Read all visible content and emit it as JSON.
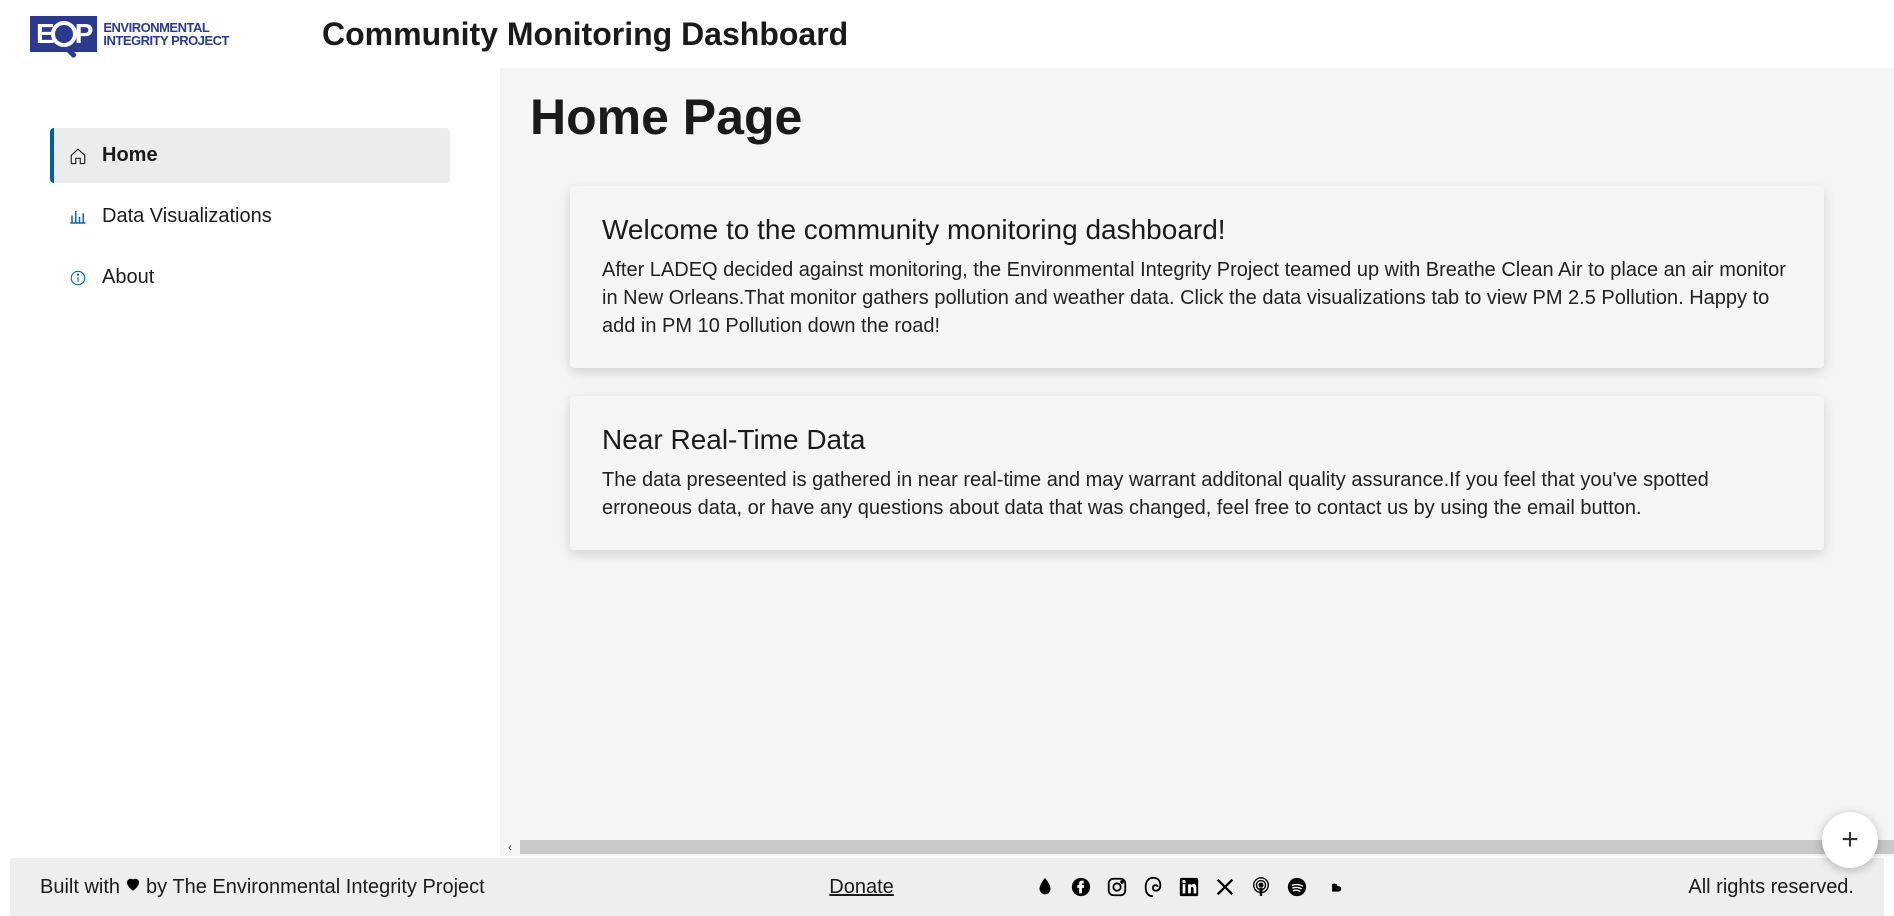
{
  "header": {
    "logo_text_line1": "ENVIRONMENTAL",
    "logo_text_line2": "INTEGRITY PROJECT",
    "app_title": "Community Monitoring Dashboard"
  },
  "sidebar": {
    "items": [
      {
        "label": "Home",
        "icon": "home-icon",
        "active": true
      },
      {
        "label": "Data Visualizations",
        "icon": "chart-icon",
        "active": false
      },
      {
        "label": "About",
        "icon": "info-icon",
        "active": false
      }
    ]
  },
  "main": {
    "page_title": "Home Page",
    "cards": [
      {
        "title": "Welcome to the community monitoring dashboard!",
        "body": "After LADEQ decided against monitoring, the Environmental Integrity Project teamed up with Breathe Clean Air to place an air monitor in New Orleans.That monitor gathers pollution and weather data. Click the data visualizations tab to view PM 2.5 Pollution. Happy to add in PM 10 Pollution down the road!"
      },
      {
        "title": "Near Real-Time Data",
        "body": "The data preseented is gathered in near real-time and may warrant additonal quality assurance.If you feel that you've spotted erroneous data, or have any questions about data that was changed, feel free to contact us by using the email button."
      }
    ]
  },
  "footer": {
    "built_prefix": "Built with",
    "built_suffix": "by The Environmental Integrity Project",
    "donate": "Donate",
    "rights": "All rights reserved."
  },
  "fab": {
    "label": "+"
  }
}
